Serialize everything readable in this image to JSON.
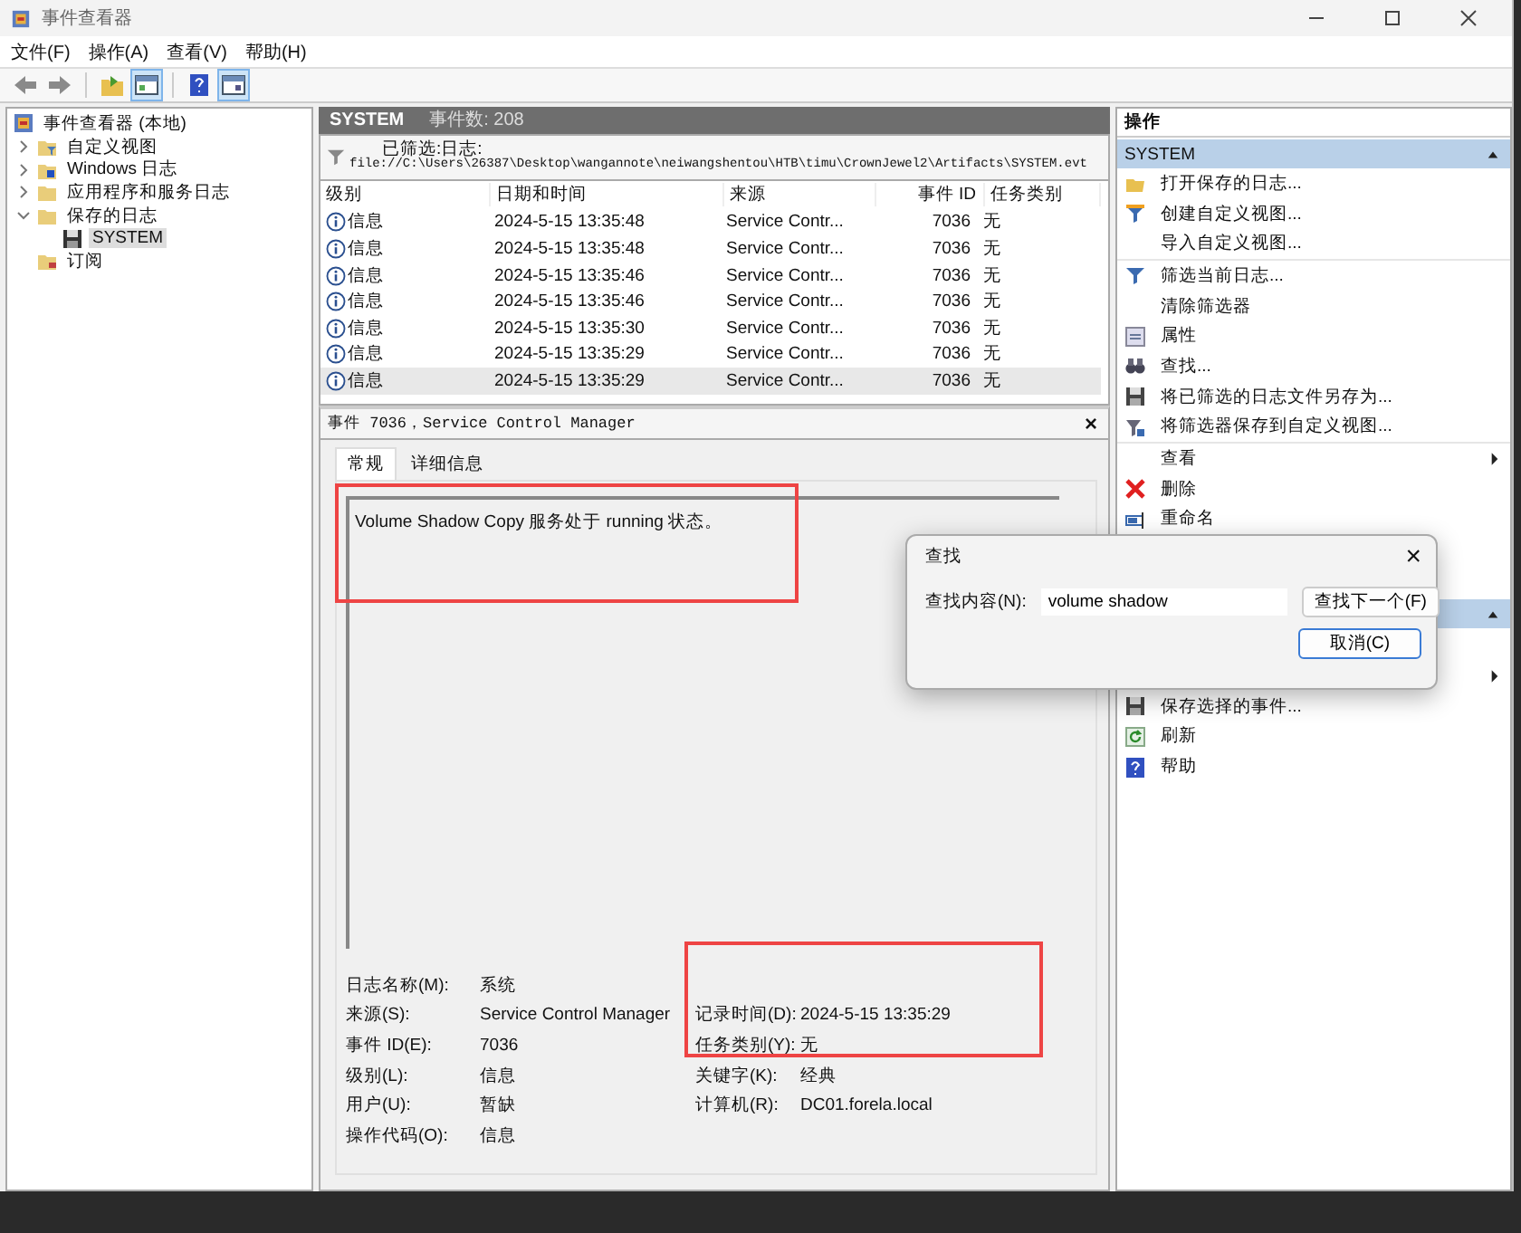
{
  "window": {
    "title": "事件查看器"
  },
  "menu": [
    "文件(F)",
    "操作(A)",
    "查看(V)",
    "帮助(H)"
  ],
  "tree": [
    {
      "label": "事件查看器 (本地)",
      "selected": false,
      "children": [
        {
          "label": "自定义视图",
          "expanded": false,
          "selected": false
        },
        {
          "label": "Windows 日志",
          "expanded": false,
          "selected": false
        },
        {
          "label": "应用程序和服务日志",
          "expanded": false,
          "selected": false
        },
        {
          "label": "保存的日志",
          "expanded": true,
          "selected": false,
          "children": [
            {
              "label": "SYSTEM",
              "selected": true
            }
          ]
        },
        {
          "label": "订阅",
          "selected": false
        }
      ]
    }
  ],
  "log_header": {
    "name": "SYSTEM",
    "count": "事件数: 208"
  },
  "filter": {
    "label": "已筛选:日志:",
    "path": "file://C:\\Users\\26387\\Desktop\\wangannote\\neiwangshentou\\HTB\\timu\\CrownJewel2\\Artifacts\\SYSTEM.evt"
  },
  "table": {
    "columns": [
      "级别",
      "日期和时间",
      "来源",
      "事件 ID",
      "任务类别"
    ],
    "rows": [
      {
        "level": "信息",
        "datetime": "2024-5-15 13:35:48",
        "source": "Service Contr...",
        "event_id": "7036",
        "task": "无",
        "selected": false
      },
      {
        "level": "信息",
        "datetime": "2024-5-15 13:35:48",
        "source": "Service Contr...",
        "event_id": "7036",
        "task": "无",
        "selected": false
      },
      {
        "level": "信息",
        "datetime": "2024-5-15 13:35:46",
        "source": "Service Contr...",
        "event_id": "7036",
        "task": "无",
        "selected": false
      },
      {
        "level": "信息",
        "datetime": "2024-5-15 13:35:46",
        "source": "Service Contr...",
        "event_id": "7036",
        "task": "无",
        "selected": false
      },
      {
        "level": "信息",
        "datetime": "2024-5-15 13:35:30",
        "source": "Service Contr...",
        "event_id": "7036",
        "task": "无",
        "selected": false
      },
      {
        "level": "信息",
        "datetime": "2024-5-15 13:35:29",
        "source": "Service Contr...",
        "event_id": "7036",
        "task": "无",
        "selected": false
      },
      {
        "level": "信息",
        "datetime": "2024-5-15 13:35:29",
        "source": "Service Contr...",
        "event_id": "7036",
        "task": "无",
        "selected": true
      }
    ]
  },
  "event_pane": {
    "title": "事件 7036，Service Control Manager",
    "close": "×",
    "tabs": [
      {
        "label": "常规",
        "selected": true
      },
      {
        "label": "详细信息",
        "selected": false
      }
    ],
    "message": "Volume Shadow Copy 服务处于 running 状态。",
    "left_fields": [
      {
        "label": "日志名称(M):",
        "value": "系统"
      },
      {
        "label": "来源(S):",
        "value": "Service Control Manager"
      },
      {
        "label": "事件 ID(E):",
        "value": "7036"
      },
      {
        "label": "级别(L):",
        "value": "信息"
      },
      {
        "label": "用户(U):",
        "value": "暂缺"
      },
      {
        "label": "操作代码(O):",
        "value": "信息"
      }
    ],
    "right_fields": [
      {
        "label": "记录时间(D):",
        "value": "2024-5-15 13:35:29"
      },
      {
        "label": "任务类别(Y):",
        "value": "无"
      },
      {
        "label": "关键字(K):",
        "value": "经典"
      },
      {
        "label": "计算机(R):",
        "value": "DC01.forela.local"
      }
    ]
  },
  "actions": {
    "title": "操作",
    "sections": [
      {
        "title": "SYSTEM",
        "expanded": true,
        "items": [
          {
            "label": "打开保存的日志...",
            "submenu": false
          },
          {
            "label": "创建自定义视图...",
            "submenu": false
          },
          {
            "label": "导入自定义视图...",
            "submenu": false
          },
          {
            "label": "筛选当前日志...",
            "submenu": false
          },
          {
            "label": "清除筛选器",
            "submenu": false
          },
          {
            "label": "属性",
            "submenu": false
          },
          {
            "label": "查找...",
            "submenu": false
          },
          {
            "label": "将已筛选的日志文件另存为...",
            "submenu": false
          },
          {
            "label": "将筛选器保存到自定义视图...",
            "submenu": false
          },
          {
            "label": "查看",
            "submenu": true
          },
          {
            "label": "删除",
            "submenu": false
          },
          {
            "label": "重命名",
            "submenu": false
          }
        ]
      },
      {
        "expanded": true,
        "items": [
          {
            "submenu": true
          },
          {
            "label": "保存选择的事件...",
            "submenu": false
          },
          {
            "label": "刷新",
            "submenu": false
          },
          {
            "label": "帮助",
            "submenu": false
          }
        ]
      }
    ]
  },
  "find_dialog": {
    "title": "查找",
    "close": "×",
    "field_label": "查找内容(N):",
    "value": "volume shadow",
    "find_next": "查找下一个(F)",
    "cancel": "取消(C)"
  }
}
